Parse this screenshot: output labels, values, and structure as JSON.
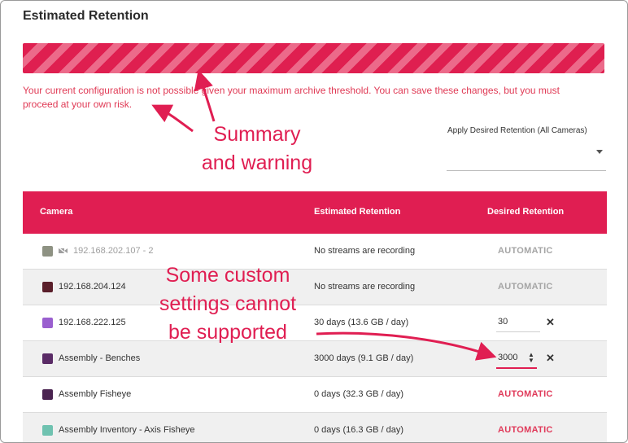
{
  "title": "Estimated Retention",
  "warning": "Your current configuration is not possible given your maximum archive threshold. You can save these changes, but you must proceed at your own risk.",
  "apply": {
    "label": "Apply Desired Retention (All Cameras)",
    "value": ""
  },
  "table": {
    "headers": {
      "camera": "Camera",
      "estimated": "Estimated Retention",
      "desired": "Desired Retention"
    },
    "rows": [
      {
        "name": "192.168.202.107 - 2",
        "estimated": "No streams are recording",
        "desired": "AUTOMATIC",
        "thumb": "#8e9283"
      },
      {
        "name": "192.168.204.124",
        "estimated": "No streams are recording",
        "desired": "AUTOMATIC",
        "thumb": "#5a1f2a"
      },
      {
        "name": "192.168.222.125",
        "estimated": "30 days (13.6 GB / day)",
        "desired": "30",
        "thumb": "#9a5fcf"
      },
      {
        "name": "Assembly - Benches",
        "estimated": "3000 days (9.1 GB / day)",
        "desired": "3000",
        "thumb": "#5a2b66"
      },
      {
        "name": "Assembly Fisheye",
        "estimated": "0 days (32.3 GB / day)",
        "desired": "AUTOMATIC",
        "thumb": "#4a2350"
      },
      {
        "name": "Assembly Inventory - Axis Fisheye",
        "estimated": "0 days (16.3 GB / day)",
        "desired": "AUTOMATIC",
        "thumb": "#6fc2b0"
      }
    ],
    "clear_symbol": "✕"
  },
  "annotations": {
    "summary": "Summary\nand warning",
    "custom": "Some custom\nsettings cannot\nbe supported"
  },
  "colors": {
    "accent": "#e01e52",
    "warning_text": "#e03a55"
  }
}
